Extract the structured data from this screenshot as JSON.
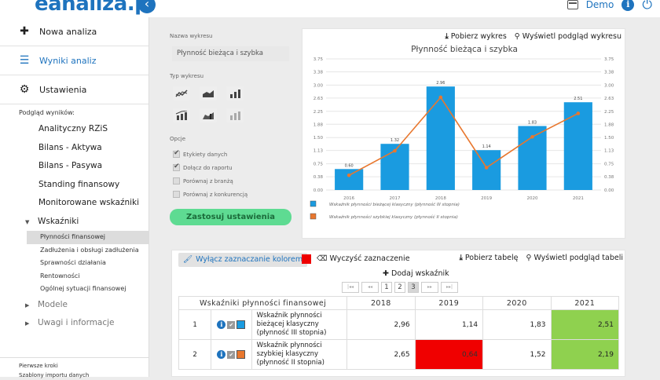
{
  "topbar": {
    "logo": "eanaliza.pl",
    "collapse_glyph": "‹",
    "demo_label": "Demo",
    "icons": [
      "calculator-icon",
      "info-icon",
      "power-icon"
    ]
  },
  "sidebar": {
    "main_items": [
      {
        "icon": "plus-icon",
        "glyph": "✚",
        "label": "Nowa analiza"
      },
      {
        "icon": "list-icon",
        "glyph": "☰",
        "label": "Wyniki analiz"
      },
      {
        "icon": "gear-icon",
        "glyph": "⚙",
        "label": "Ustawienia"
      }
    ],
    "preview_header": "Podgląd wyników:",
    "sub_items": [
      "Analityczny RZiS",
      "Bilans - Aktywa",
      "Bilans - Pasywa",
      "Standing finansowy",
      "Monitorowane wskaźniki"
    ],
    "indicators_label": "Wskaźniki",
    "indicator_items": [
      "Płynności finansowej",
      "Zadłużenia i obsługi zadłużenia",
      "Sprawności działania",
      "Rentowności",
      "Ogólnej sytuacji finansowej"
    ],
    "models_label": "Modele",
    "notes_label": "Uwagi i informacje",
    "footer_links": [
      "Pierwsze kroki",
      "Szablony importu danych"
    ]
  },
  "options": {
    "chart_name_label": "Nazwa wykresu",
    "chart_name_value": "Płynność bieżąca i szybka",
    "chart_type_label": "Typ wykresu",
    "options_label": "Opcje",
    "checkboxes": [
      {
        "label": "Etykiety danych",
        "checked": true
      },
      {
        "label": "Dołącz do raportu",
        "checked": true
      },
      {
        "label": "Porównaj z branżą",
        "checked": false
      },
      {
        "label": "Porównaj z konkurencją",
        "checked": false
      }
    ],
    "apply_label": "Zastosuj ustawienia"
  },
  "chart_panel": {
    "download_label": "Pobierz wykres",
    "preview_label": "Wyświetl podgląd wykresu"
  },
  "chart_data": {
    "type": "bar",
    "title": "Płynność bieżąca i szybka",
    "categories": [
      "2016",
      "2017",
      "2018",
      "2019",
      "2020",
      "2021"
    ],
    "series": [
      {
        "name": "Wskaźnik płynności bieżącej klasyczny (płynność III stopnia)",
        "type": "bar",
        "color": "#1a9be0",
        "values": [
          0.6,
          1.32,
          2.96,
          1.14,
          1.83,
          2.51
        ]
      },
      {
        "name": "Wskaźnik płynności szybkiej klasyczny (płynność II stopnia)",
        "type": "line",
        "color": "#e8772e",
        "values": [
          0.42,
          1.12,
          2.65,
          0.64,
          1.52,
          2.19
        ]
      }
    ],
    "bar_labels": [
      "0.60",
      "1.32",
      "2.96",
      "1.14",
      "1.83",
      "2.51"
    ],
    "yticks": [
      "0.00",
      "0.38",
      "0.75",
      "1.13",
      "1.50",
      "1.88",
      "2.25",
      "2.63",
      "3.00",
      "3.38",
      "3.75"
    ],
    "ylim": [
      0,
      3.75
    ],
    "grid": true,
    "legend_position": "bottom-left"
  },
  "table_panel": {
    "toggle_color_label": "Wyłącz zaznaczanie kolorem",
    "clear_selection_label": "Wyczyść zaznaczenie",
    "download_table_label": "Pobierz tabelę",
    "preview_table_label": "Wyświetl podgląd tabeli",
    "add_indicator_label": "Dodaj wskaźnik",
    "pager": {
      "first": "|◂◂",
      "prev": "◂◂",
      "pages": [
        "1",
        "2",
        "3"
      ],
      "current": "3",
      "next": "▸▸",
      "last": "▸▸|"
    },
    "header": {
      "title": "Wskaźniki płynności finansowej",
      "years": [
        "2018",
        "2019",
        "2020",
        "2021"
      ]
    },
    "rows": [
      {
        "num": "1",
        "label": "Wskaźnik płynności bieżącej klasyczny (płynność III stopnia)",
        "swatch": "#1a9be0",
        "values": [
          "2,96",
          "1,14",
          "1,83",
          "2,51"
        ],
        "highlight": [
          "",
          "",
          "",
          "green"
        ]
      },
      {
        "num": "2",
        "label": "Wskaźnik płynności szybkiej klasyczny (płynność II stopnia)",
        "swatch": "#e8772e",
        "values": [
          "2,65",
          "0,64",
          "1,52",
          "2,19"
        ],
        "highlight": [
          "",
          "red",
          "",
          "green"
        ]
      }
    ]
  }
}
